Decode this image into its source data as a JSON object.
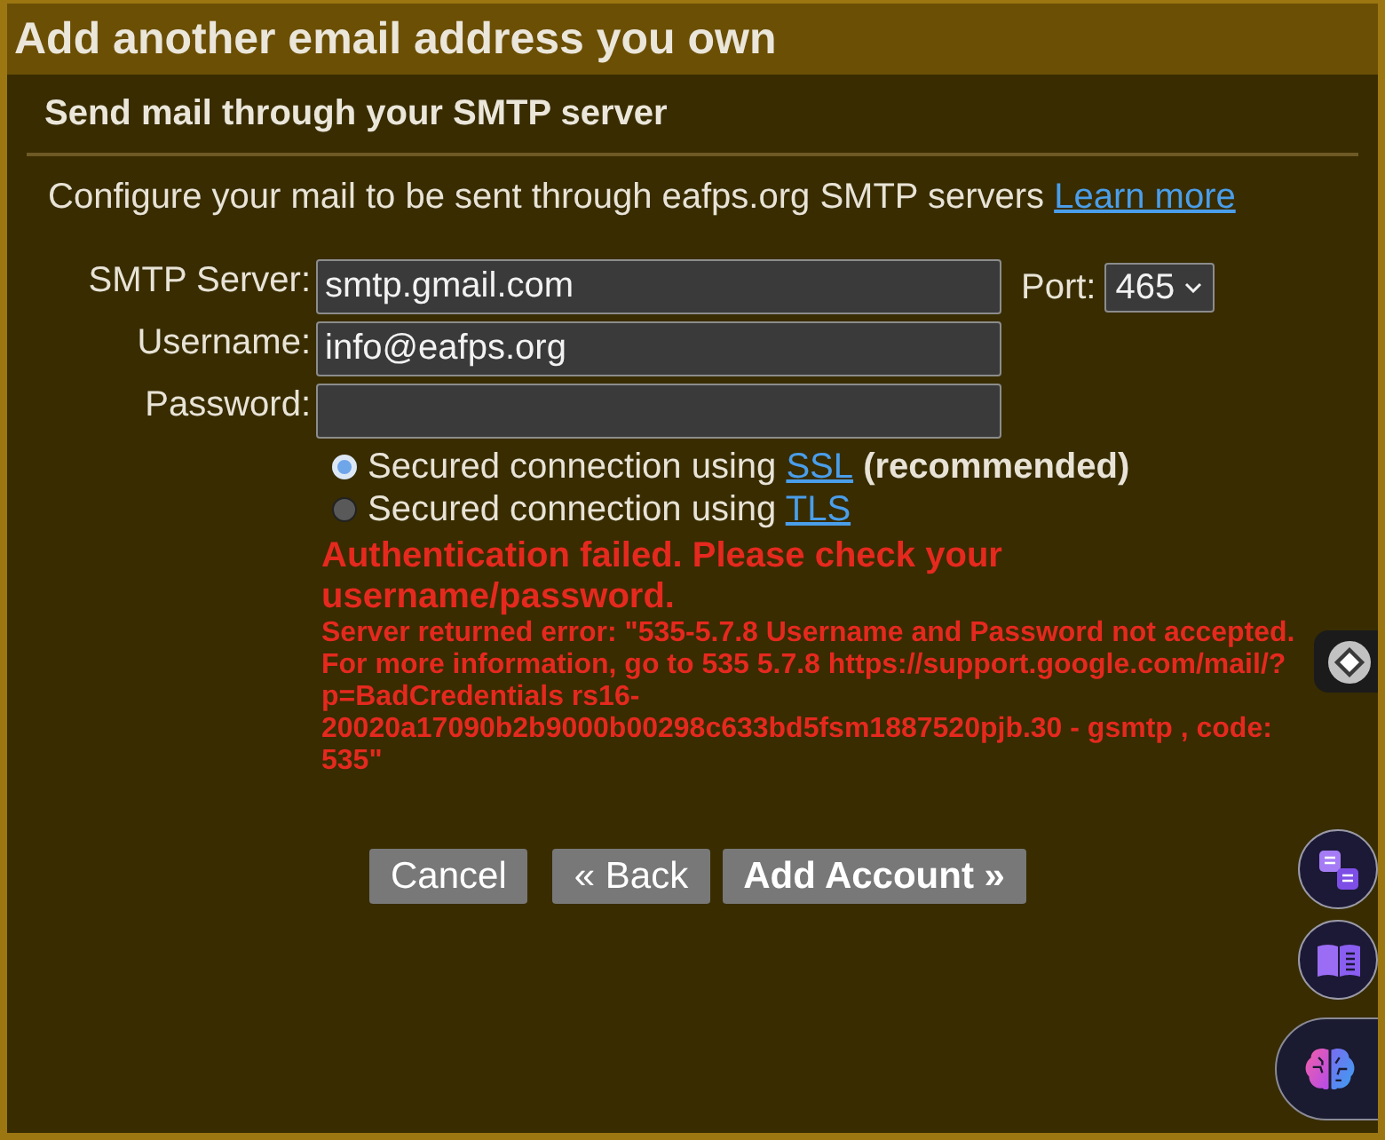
{
  "window": {
    "title": "Add another email address you own"
  },
  "section": {
    "title": "Send mail through your SMTP server"
  },
  "intro": {
    "text": "Configure your mail to be sent through eafps.org SMTP servers",
    "link": "Learn more"
  },
  "form": {
    "fields": [
      {
        "label": "SMTP Server:",
        "value": "smtp.gmail.com"
      },
      {
        "label": "Username:",
        "value": "info@eafps.org"
      },
      {
        "label": "Password:"
      }
    ],
    "port": {
      "label": "Port:",
      "value": "465"
    }
  },
  "connection_options": [
    {
      "text": "Secured connection using",
      "link": "SSL",
      "note": "(recommended)",
      "selected": true
    },
    {
      "text": "Secured connection using",
      "link": "TLS",
      "selected": false
    }
  ],
  "error": {
    "heading": "Authentication failed. Please check your username/password.",
    "details": "Server returned error: \"535-5.7.8 Username and Password not accepted. For more information, go to 535 5.7.8 https://support.google.com/mail/?p=BadCredentials rs16-20020a17090b2b9000b00298c633bd5fsm1887520pjb.30 - gsmtp , code: 535\""
  },
  "buttons": [
    {
      "label": "Cancel",
      "kind": "cancel"
    },
    {
      "label": "« Back",
      "kind": "back"
    },
    {
      "label": "Add Account »",
      "kind": "submit"
    }
  ]
}
